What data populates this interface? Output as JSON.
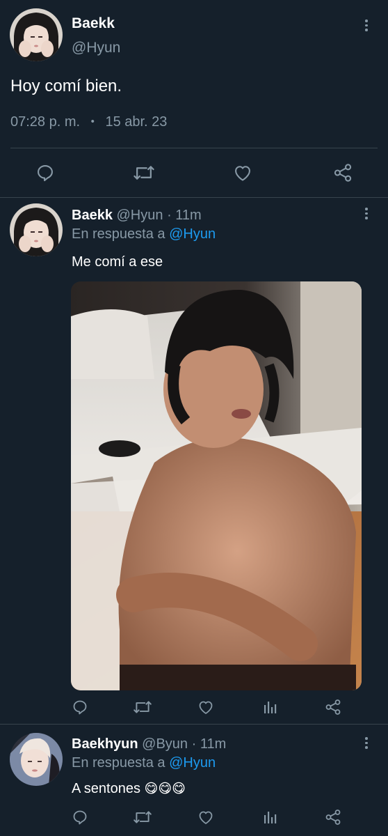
{
  "main_tweet": {
    "display_name": "Baekk",
    "handle": "@Hyun",
    "text": "Hoy comí bien.",
    "time": "07:28 p. m.",
    "separator": "•",
    "date": "15 abr. 23"
  },
  "reply_1": {
    "display_name": "Baekk",
    "handle": "@Hyun",
    "time_ago": "· 11m",
    "in_reply_prefix": "En respuesta a",
    "in_reply_handle": "@Hyun",
    "text": "Me comí a ese"
  },
  "reply_2": {
    "display_name": "Baekhyun",
    "handle": "@Byun",
    "time_ago": "· 11m",
    "in_reply_prefix": "En respuesta a",
    "in_reply_handle": "@Hyun",
    "text": "A sentones",
    "emojis": "😋😋😋"
  },
  "colors": {
    "background": "#15202b",
    "secondary_text": "#8899a6",
    "link": "#1d9bf0",
    "divider": "#38444d"
  },
  "icons": [
    "reply-icon",
    "retweet-icon",
    "like-icon",
    "share-icon",
    "analytics-icon",
    "more-icon"
  ]
}
